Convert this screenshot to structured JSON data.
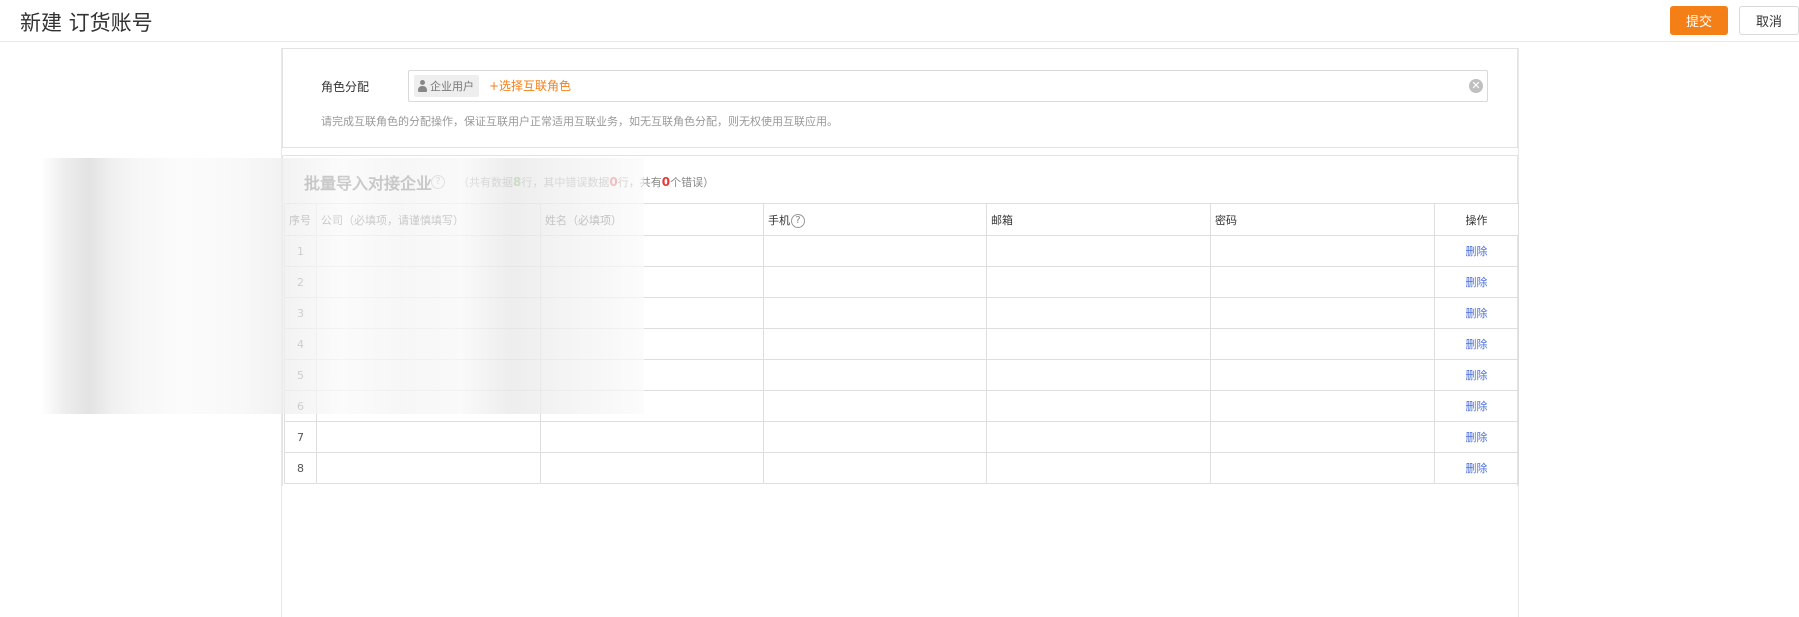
{
  "header": {
    "title": "新建 订货账号",
    "submit_label": "提交",
    "cancel_label": "取消"
  },
  "role": {
    "label": "角色分配",
    "tag": "企业用户",
    "add_label": "+选择互联角色",
    "hint": "请完成互联角色的分配操作，保证互联用户正常适用互联业务，如无互联角色分配，则无权使用互联应用。"
  },
  "import": {
    "title": "批量导入对接企业",
    "summary_prefix": "（共有数据",
    "total_rows": "8",
    "summary_mid1": "行，其中错误数据",
    "error_rows": "0",
    "summary_mid2": "行，共有",
    "error_count": "0",
    "summary_suffix": "个错误）",
    "colors": {
      "ok": "#6ab04c",
      "error": "#e53935",
      "accent": "#f57f17",
      "link": "#4a6fd6"
    }
  },
  "table": {
    "headers": {
      "index": "序号",
      "company": "公司（必填项，请谨慎填写）",
      "name": "姓名（必填项）",
      "phone": "手机",
      "email": "邮箱",
      "password": "密码",
      "operation": "操作"
    },
    "rows": [
      {
        "index": "1",
        "delete": "删除"
      },
      {
        "index": "2",
        "delete": "删除"
      },
      {
        "index": "3",
        "delete": "删除"
      },
      {
        "index": "4",
        "delete": "删除"
      },
      {
        "index": "5",
        "delete": "删除"
      },
      {
        "index": "6",
        "delete": "删除"
      },
      {
        "index": "7",
        "delete": "删除"
      },
      {
        "index": "8",
        "delete": "删除"
      }
    ]
  }
}
